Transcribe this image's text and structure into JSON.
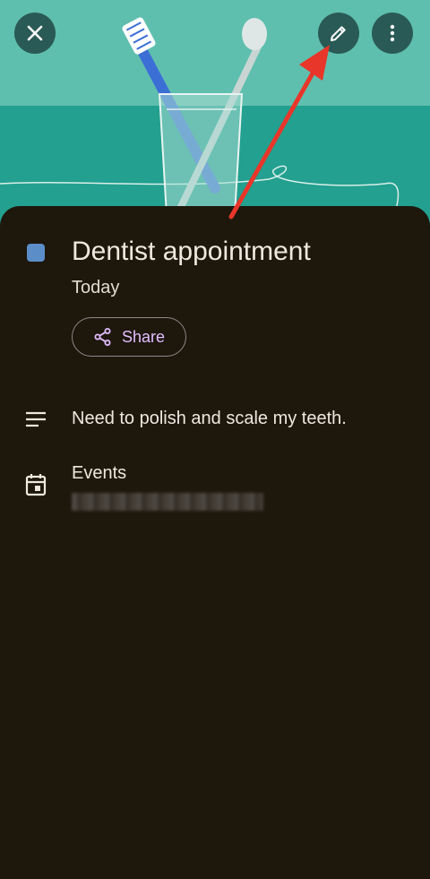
{
  "header": {
    "close_icon": "close-icon",
    "edit_icon": "edit-pencil-icon",
    "more_icon": "more-vertical-icon"
  },
  "event": {
    "color": "#5b8ec9",
    "title": "Dentist appointment",
    "date": "Today",
    "share_label": "Share",
    "description": "Need to polish and scale my teeth.",
    "calendar_label": "Events"
  },
  "colors": {
    "background": "#1d170c",
    "header_teal": "#5dbdad",
    "accent_pink": "#e3bdff",
    "annotation_arrow": "#e8362a"
  }
}
